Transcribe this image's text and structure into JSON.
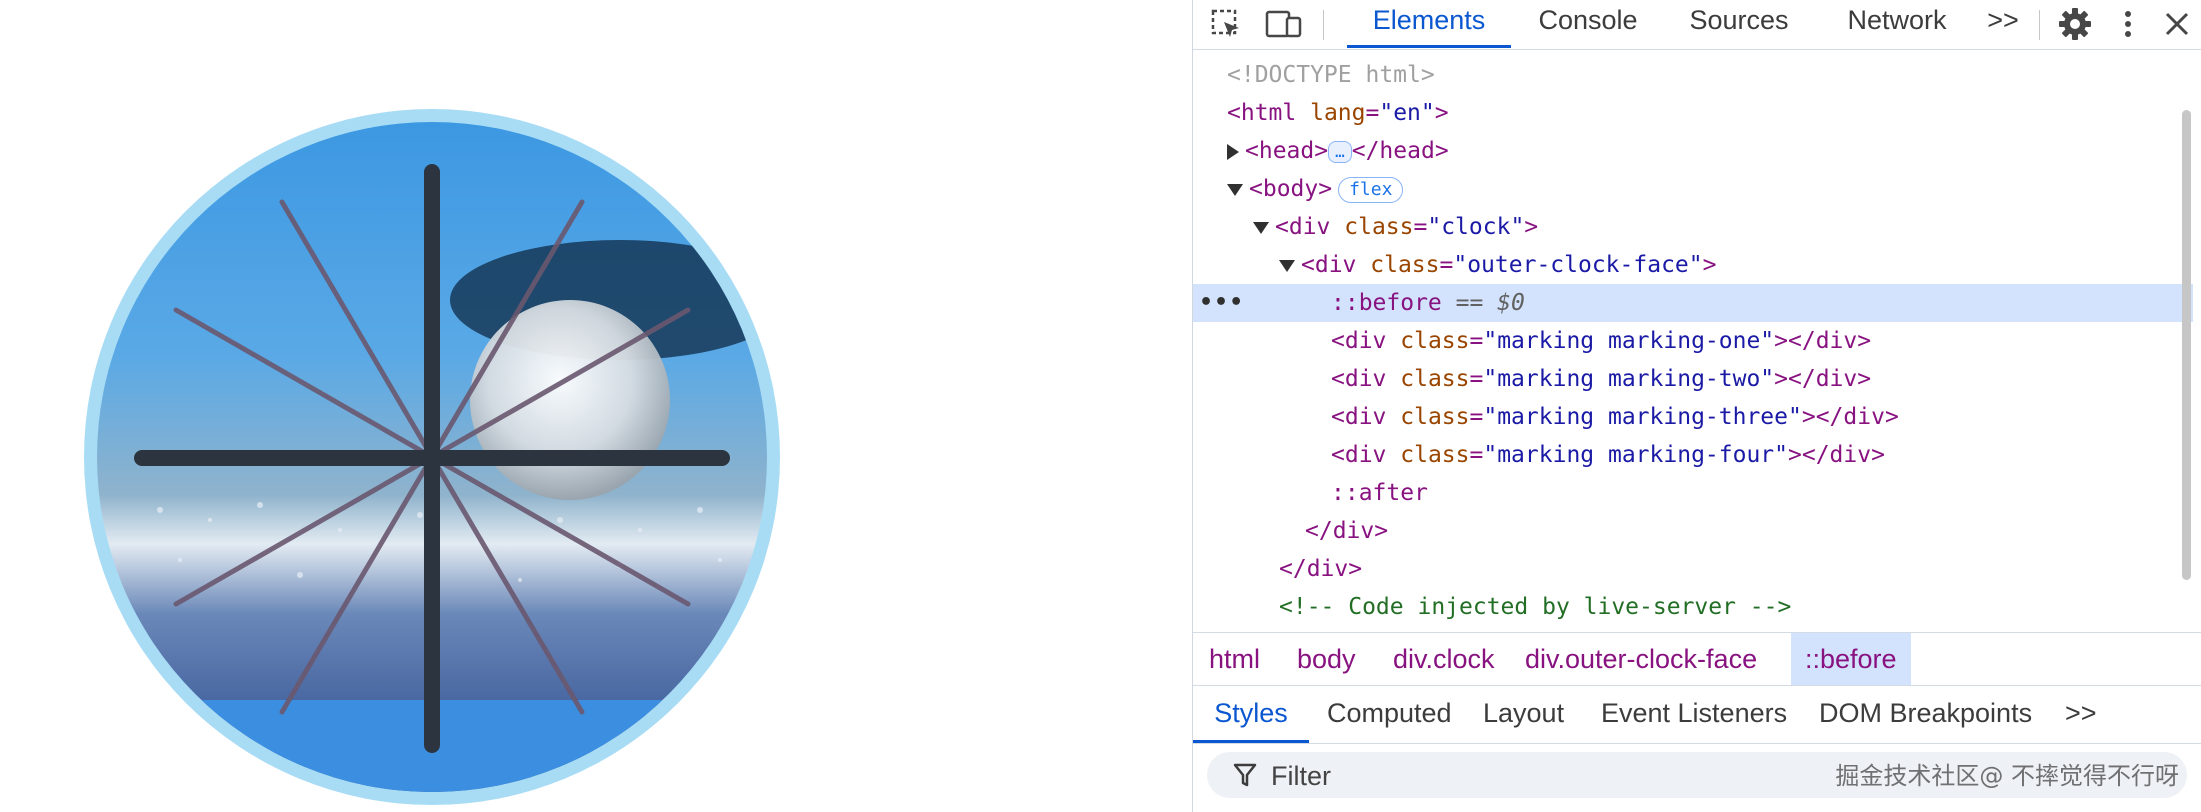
{
  "devtools": {
    "tabs": [
      "Elements",
      "Console",
      "Sources",
      "Network"
    ],
    "active_tab": "Elements",
    "more_tabs_glyph": ">>",
    "dom_lines": [
      {
        "doctype": "<!DOCTYPE html>"
      },
      {
        "open": "<html",
        "attr": "lang",
        "val": "\"en\"",
        "close": ">"
      },
      {
        "open": "<head>",
        "badge": "…",
        "end": "</head>"
      },
      {
        "open": "<body>",
        "badge": "flex"
      },
      {
        "open": "<div",
        "attr": "class",
        "val": "\"clock\"",
        "close": ">"
      },
      {
        "open": "<div",
        "attr": "class",
        "val": "\"outer-clock-face\"",
        "close": ">"
      },
      {
        "pseudo": "::before",
        "eq": "== $0"
      },
      {
        "open": "<div",
        "attr": "class",
        "val": "\"marking marking-one\"",
        "close": "></div>"
      },
      {
        "open": "<div",
        "attr": "class",
        "val": "\"marking marking-two\"",
        "close": "></div>"
      },
      {
        "open": "<div",
        "attr": "class",
        "val": "\"marking marking-three\"",
        "close": "></div>"
      },
      {
        "open": "<div",
        "attr": "class",
        "val": "\"marking marking-four\"",
        "close": "></div>"
      },
      {
        "pseudo": "::after"
      },
      {
        "open": "</div>"
      },
      {
        "open": "</div>"
      },
      {
        "comment": "<!-- Code injected by live-server -->"
      }
    ],
    "breadcrumb": [
      "html",
      "body",
      "div.clock",
      "div.outer-clock-face",
      "::before"
    ],
    "active_breadcrumb": "::before",
    "lower_tabs": [
      "Styles",
      "Computed",
      "Layout",
      "Event Listeners",
      "DOM Breakpoints"
    ],
    "active_lower_tab": "Styles",
    "filter": {
      "placeholder": "Filter"
    },
    "watermark": "掘金技术社区@ 不摔觉得不行呀"
  },
  "clock": {
    "ring_color": "#a8dcf5",
    "hand_color": "#2c3440",
    "marking_color": "#6a5870"
  },
  "colors": {
    "accent": "#0b57d0",
    "selection": "#d3e3fd"
  }
}
